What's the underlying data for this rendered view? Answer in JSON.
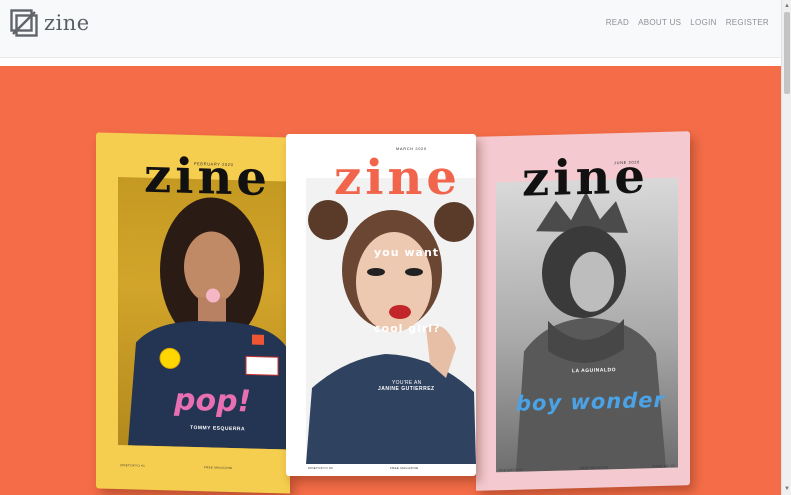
{
  "brand": {
    "name": "zine"
  },
  "nav": {
    "read": "READ",
    "about": "ABOUT US",
    "login": "LOGIN",
    "register": "REGISTER"
  },
  "colors": {
    "hero_bg": "#f46d48",
    "cover1_bg": "#f5ce4f",
    "cover2_bg": "#ffffff",
    "cover3_bg": "#f4c9cf"
  },
  "covers": [
    {
      "masthead": "zine",
      "issue": "february 2020",
      "headline": "pop!",
      "person": "TOMMY ESQUERRA",
      "foot_left": "zineTOKYO #1",
      "foot_mid": "FREE MAGAZINE"
    },
    {
      "masthead": "zine",
      "issue": "march 2020",
      "line1": "you want",
      "line2": "cool girl?",
      "tag": "you're an",
      "person": "JANINE GUTIERREZ",
      "foot_left": "zineTOKYO #2",
      "foot_mid": "FREE MAGAZINE"
    },
    {
      "masthead": "zine",
      "issue": "june 2020",
      "headline": "boy wonder",
      "person": "LA AGUINALDO",
      "foot_left": "zineTOKYO #3",
      "foot_mid": "FREE MAGAZINE",
      "foot_right": "ISSUE NO. 03"
    }
  ]
}
